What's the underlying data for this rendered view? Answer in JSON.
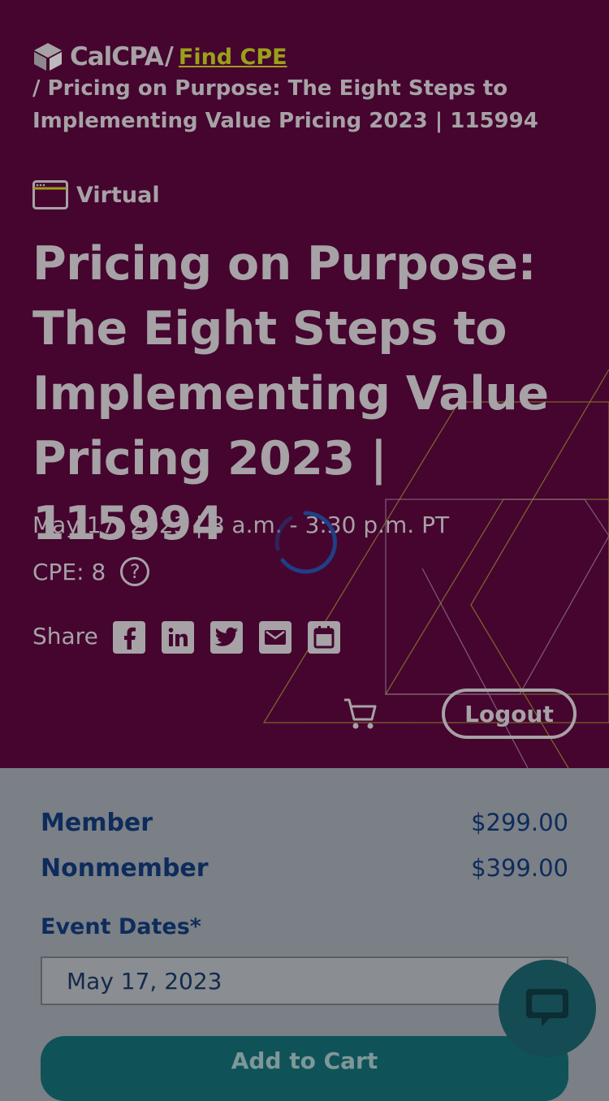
{
  "breadcrumb": {
    "logo_text": "CalCPA",
    "separator": "/",
    "link": "Find CPE",
    "current": "/ Pricing on Purpose: The Eight Steps to Implementing Value Pricing 2023 | 115994"
  },
  "event": {
    "format": "Virtual",
    "format_icon": "browser-window-icon",
    "title": "Pricing on Purpose: The Eight Steps to Implementing Value Pricing 2023 | 115994",
    "date": "May 17, 2023 | 8 a.m. - 3:30 p.m. PT",
    "cpe": "CPE: 8",
    "help_icon": "?"
  },
  "share": {
    "label": "Share",
    "icons": [
      "facebook-icon",
      "linkedin-icon",
      "twitter-icon",
      "email-icon",
      "calendar-icon"
    ]
  },
  "header_actions": {
    "cart_icon": "cart-icon",
    "logout_label": "Logout"
  },
  "pricing": {
    "rows": [
      {
        "name": "Member",
        "price": "$299.00"
      },
      {
        "name": "Nonmember",
        "price": "$399.00"
      }
    ]
  },
  "dates": {
    "label": "Event Dates*",
    "selected": "May 17, 2023"
  },
  "actions": {
    "add_to_cart": "Add to Cart"
  },
  "colors": {
    "hero_bg": "#45052f",
    "text_navy": "#0d2c5c",
    "link": "#9aa01a",
    "button_teal": "#0f5358"
  }
}
